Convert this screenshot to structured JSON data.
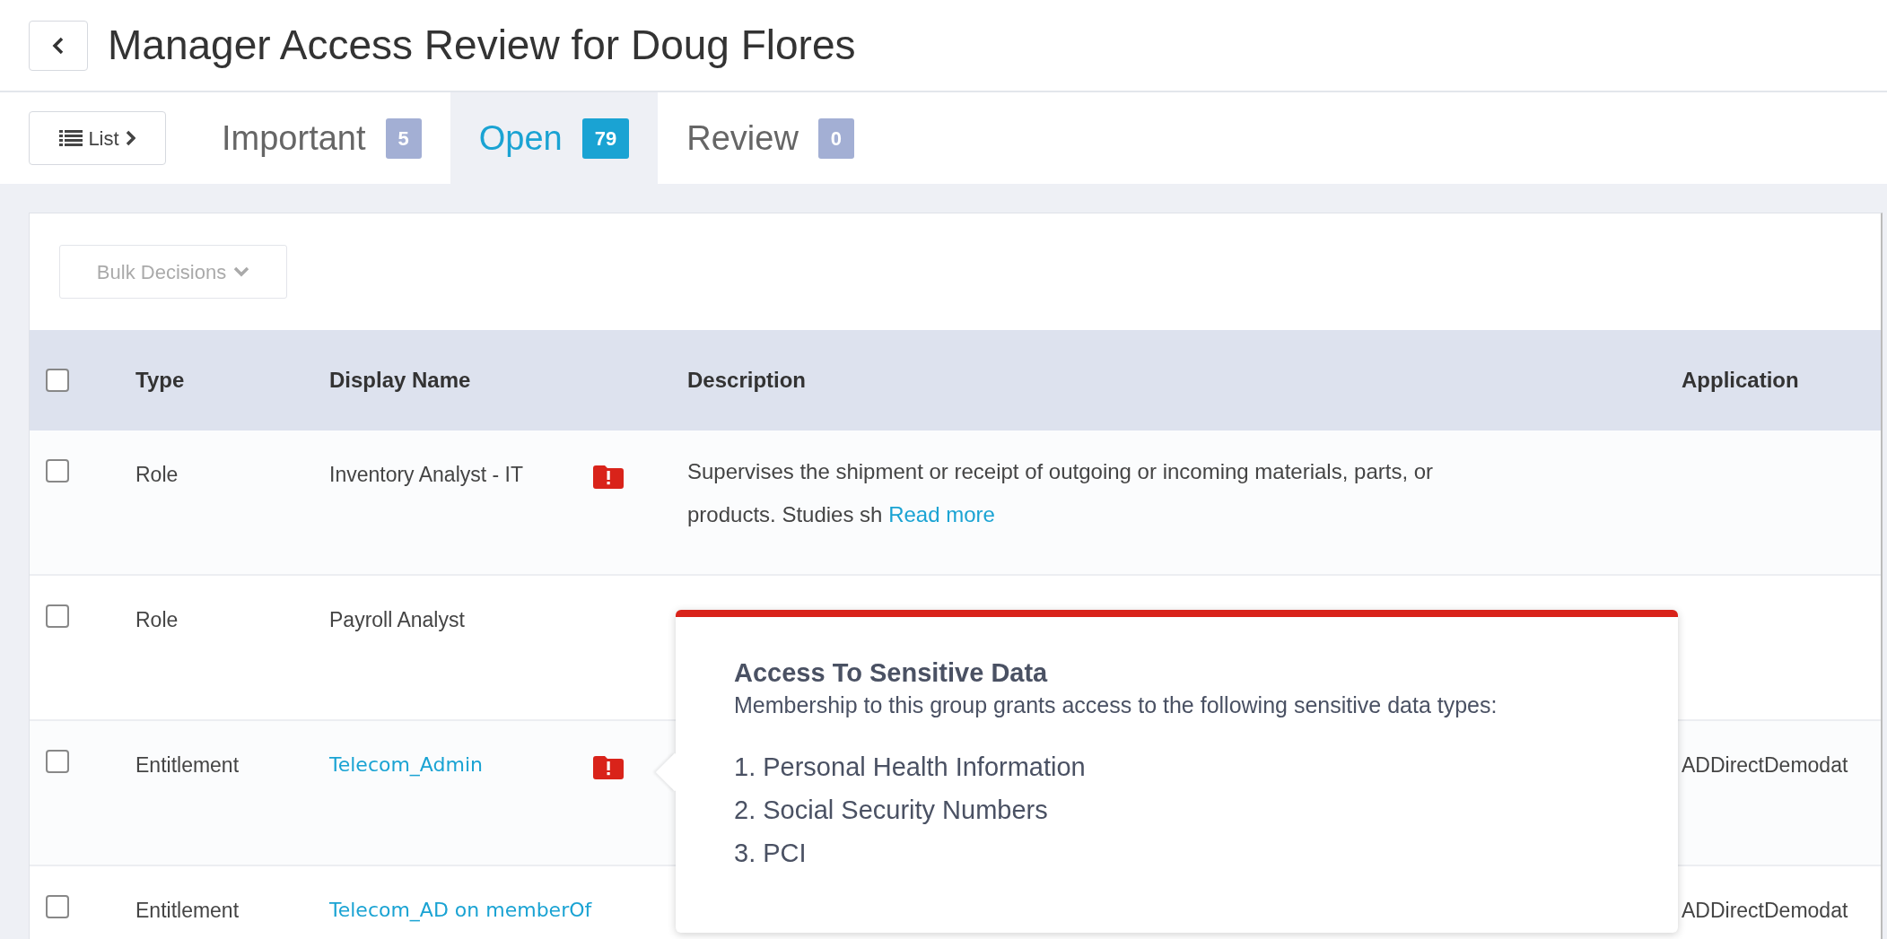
{
  "header": {
    "title": "Manager Access Review for Doug Flores"
  },
  "list_button": {
    "label": "List"
  },
  "tabs": [
    {
      "label": "Important",
      "count": "5",
      "selected": false
    },
    {
      "label": "Open",
      "count": "79",
      "selected": true
    },
    {
      "label": "Review",
      "count": "0",
      "selected": false
    }
  ],
  "bulk_button": {
    "label": "Bulk Decisions"
  },
  "table": {
    "select_all_checked": false,
    "columns": [
      "Type",
      "Display Name",
      "Description",
      "Application"
    ],
    "rows": [
      {
        "checked": false,
        "type": "Role",
        "display_name": "Inventory Analyst - IT",
        "linked": false,
        "flagged": true,
        "description": "Supervises the shipment or receipt of outgoing or incoming materials, parts, or products. Studies sh",
        "read_more": "Read more",
        "application": ""
      },
      {
        "checked": false,
        "type": "Role",
        "display_name": "Payroll Analyst",
        "linked": false,
        "flagged": false,
        "description": "",
        "read_more": "",
        "application": ""
      },
      {
        "checked": false,
        "type": "Entitlement",
        "display_name": "Telecom_Admin",
        "linked": true,
        "flagged": true,
        "description": "",
        "read_more": "",
        "application": "ADDirectDemodat"
      },
      {
        "checked": false,
        "type": "Entitlement",
        "display_name": "Telecom_AD on memberOf",
        "linked": true,
        "flagged": false,
        "description": "",
        "read_more": "",
        "application": "ADDirectDemodat"
      }
    ]
  },
  "popover": {
    "title": "Access To Sensitive Data",
    "text": "Membership to this group grants access to the following sensitive data types:",
    "items": [
      "1. Personal Health Information",
      "2. Social Security Numbers",
      "3. PCI"
    ]
  }
}
